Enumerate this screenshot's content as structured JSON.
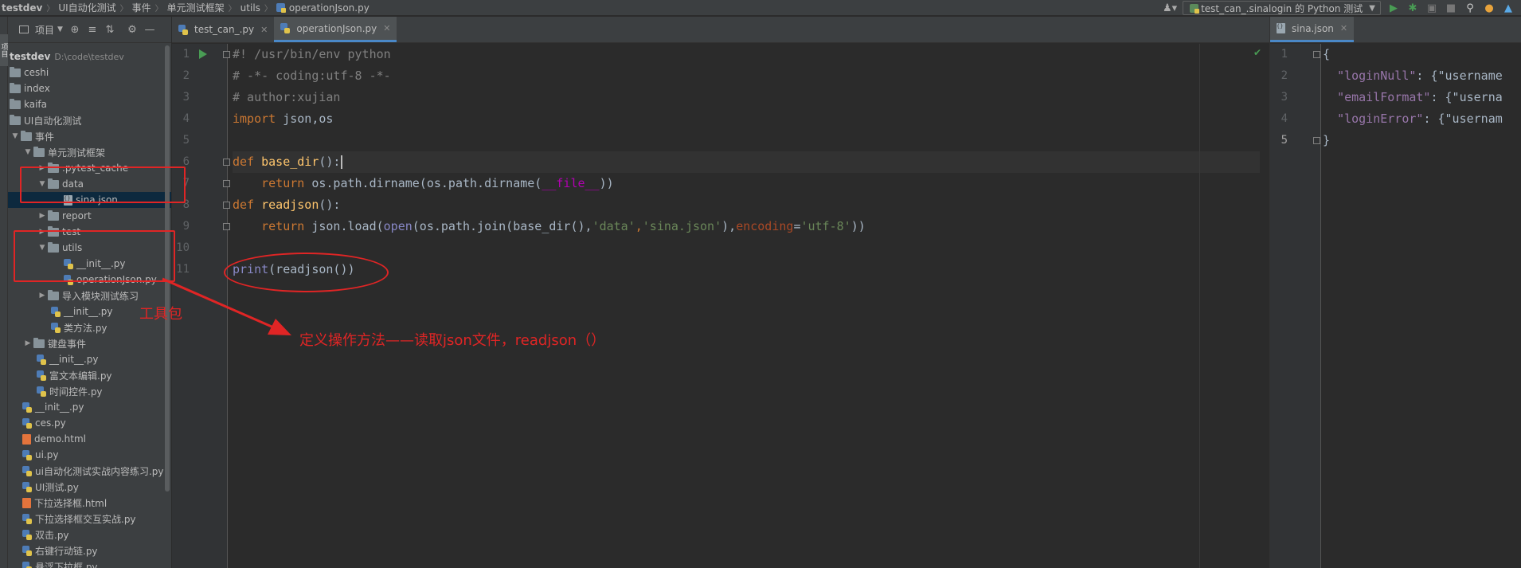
{
  "breadcrumb": {
    "items": [
      "testdev",
      "UI自动化测试",
      "事件",
      "单元测试框架",
      "utils"
    ],
    "file": "operationJson.py"
  },
  "toolbar": {
    "run_config": "test_can_.sinalogin 的 Python 测试",
    "icons": [
      "user-icon",
      "run-icon",
      "debug-icon",
      "coverage-icon",
      "stop-icon",
      "search-icon",
      "update-icon",
      "jetbrains-icon"
    ]
  },
  "left_stripe": {
    "label": "项目"
  },
  "project_panel": {
    "dropdown_label": "项目",
    "tree": [
      {
        "label": "testdev",
        "path": "D:\\code\\testdev",
        "type": "root"
      },
      {
        "label": "ceshi",
        "type": "folder"
      },
      {
        "label": "index",
        "type": "folder"
      },
      {
        "label": "kaifa",
        "type": "folder"
      },
      {
        "label": "UI自动化测试",
        "type": "folder"
      },
      {
        "label": "事件",
        "type": "folder"
      },
      {
        "label": "单元测试框架",
        "type": "folder"
      },
      {
        "label": ".pytest_cache",
        "type": "folder"
      },
      {
        "label": "data",
        "type": "folder"
      },
      {
        "label": "sina.json",
        "type": "json"
      },
      {
        "label": "report",
        "type": "folder"
      },
      {
        "label": "test",
        "type": "folder"
      },
      {
        "label": "utils",
        "type": "folder"
      },
      {
        "label": "__init__.py",
        "type": "py"
      },
      {
        "label": "operationJson.py",
        "type": "py"
      },
      {
        "label": "导入模块测试练习",
        "type": "folder"
      },
      {
        "label": "__init__.py",
        "type": "py"
      },
      {
        "label": "类方法.py",
        "type": "py"
      },
      {
        "label": "键盘事件",
        "type": "folder"
      },
      {
        "label": "__init__.py",
        "type": "py"
      },
      {
        "label": "富文本编辑.py",
        "type": "py"
      },
      {
        "label": "时间控件.py",
        "type": "py"
      },
      {
        "label": "__init__.py",
        "type": "py"
      },
      {
        "label": "ces.py",
        "type": "py"
      },
      {
        "label": "demo.html",
        "type": "html"
      },
      {
        "label": "ui.py",
        "type": "py"
      },
      {
        "label": "ui自动化测试实战内容练习.py",
        "type": "py"
      },
      {
        "label": "UI测试.py",
        "type": "py"
      },
      {
        "label": "下拉选择框.html",
        "type": "html"
      },
      {
        "label": "下拉选择框交互实战.py",
        "type": "py"
      },
      {
        "label": "双击.py",
        "type": "py"
      },
      {
        "label": "右键行动链.py",
        "type": "py"
      },
      {
        "label": "悬浮下拉框.py",
        "type": "py"
      }
    ]
  },
  "editor": {
    "tabs": [
      {
        "label": "test_can_.py",
        "active": false
      },
      {
        "label": "operationJson.py",
        "active": true
      }
    ],
    "line_numbers": [
      "1",
      "2",
      "3",
      "4",
      "5",
      "6",
      "7",
      "8",
      "9",
      "10",
      "11"
    ],
    "code": {
      "l1": "#! /usr/bin/env python",
      "l2": "# -*- coding:utf-8 -*-",
      "l3": "# author:xujian",
      "l4_kw": "import",
      "l4_rest": " json,os",
      "l6_kw": "def",
      "l6_fn": "base_dir",
      "l6_rest": "():",
      "l7_kw": "return",
      "l7_rest": " os.path.dirname(os.path.dirname(",
      "l7_dn": "__file__",
      "l7_end": "))",
      "l8_kw": "def",
      "l8_fn": "readjson",
      "l8_rest": "():",
      "l9_kw": "return",
      "l9_a": " json.load(",
      "l9_bi": "open",
      "l9_b": "(os.path.join(base_dir(),",
      "l9_s1": "'data'",
      "l9_c": ",",
      "l9_s2": "'sina.json'",
      "l9_d": "),",
      "l9_nm": "encoding",
      "l9_e": "=",
      "l9_s3": "'utf-8'",
      "l9_f": "))",
      "l11_bi": "print",
      "l11_rest": "(readjson())"
    }
  },
  "right_editor": {
    "tab": "sina.json",
    "line_numbers": [
      "1",
      "2",
      "3",
      "4",
      "5"
    ],
    "code": {
      "l1": "{",
      "l2_key": "\"loginNull\"",
      "l2_rest": ": {\"username",
      "l3_key": "\"emailFormat\"",
      "l3_rest": ": {\"userna",
      "l4_key": "\"loginError\"",
      "l4_rest": ": {\"usernam",
      "l5": "}"
    }
  },
  "annotations": {
    "toolkit_label": "工具包",
    "method_label": "定义操作方法——读取json文件，readjson（）",
    "color": "#e02525"
  }
}
